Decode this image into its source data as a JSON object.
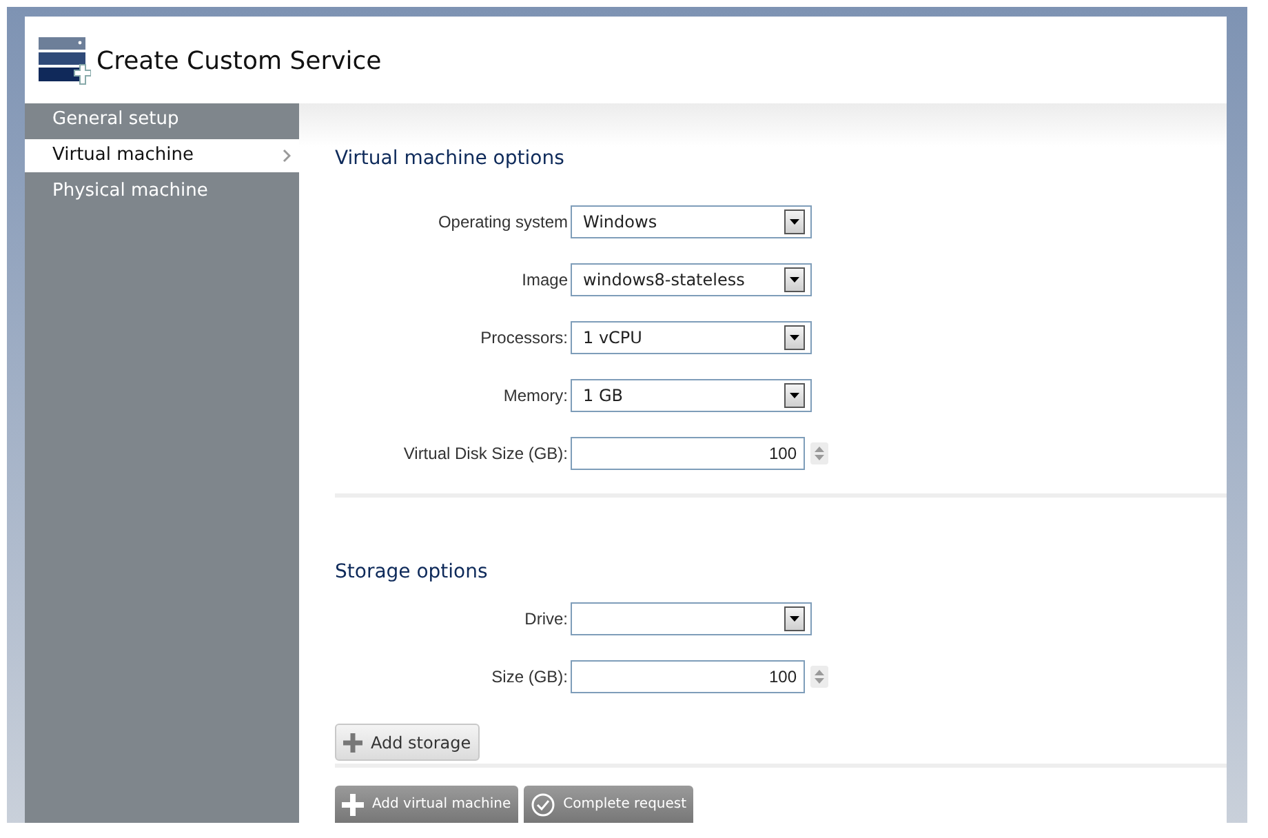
{
  "window": {
    "title": "Create Custom Service"
  },
  "sidebar": {
    "items": [
      {
        "label": "General setup",
        "selected": false
      },
      {
        "label": "Virtual machine",
        "selected": true
      },
      {
        "label": "Physical machine",
        "selected": false
      }
    ]
  },
  "sections": [
    {
      "title": "Virtual machine options",
      "fields": [
        {
          "kind": "select",
          "label": "Operating system",
          "value": "Windows"
        },
        {
          "kind": "select",
          "label": "Image",
          "value": "windows8-stateless"
        },
        {
          "kind": "select",
          "label": "Processors:",
          "value": "1 vCPU"
        },
        {
          "kind": "select",
          "label": "Memory:",
          "value": "1 GB"
        },
        {
          "kind": "number",
          "label": "Virtual Disk Size (GB):",
          "value": "100"
        }
      ]
    },
    {
      "title": "Storage options",
      "fields": [
        {
          "kind": "select",
          "label": "Drive:"
        },
        {
          "kind": "number",
          "label": "Size (GB):",
          "value": "100"
        }
      ],
      "button": "Add storage"
    }
  ],
  "footer_buttons": [
    {
      "kind": "add",
      "label": "Add virtual machine"
    },
    {
      "kind": "complete",
      "label": "Complete request"
    }
  ]
}
